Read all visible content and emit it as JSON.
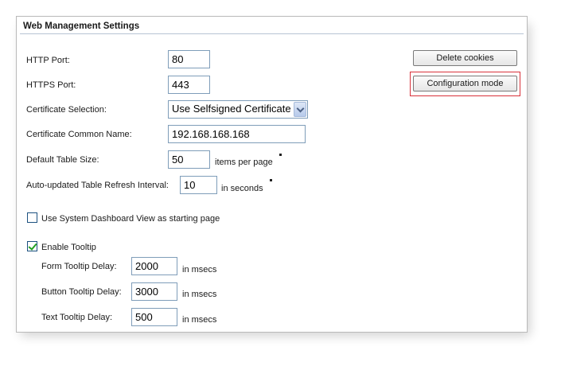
{
  "section": {
    "title": "Web Management Settings"
  },
  "fields": {
    "http_port": {
      "label": "HTTP Port:",
      "value": "80"
    },
    "https_port": {
      "label": "HTTPS Port:",
      "value": "443"
    },
    "cert_selection": {
      "label": "Certificate Selection:",
      "value": "Use Selfsigned Certificate"
    },
    "cert_common_name": {
      "label": "Certificate Common Name:",
      "value": "192.168.168.168"
    },
    "table_size": {
      "label": "Default Table Size:",
      "value": "50",
      "suffix": "items per page"
    },
    "refresh_interval": {
      "label": "Auto-updated Table Refresh Interval:",
      "value": "10",
      "suffix": "in seconds"
    }
  },
  "options": {
    "dashboard_start": {
      "label": "Use System Dashboard View as starting page",
      "checked": false
    },
    "enable_tooltip": {
      "label": "Enable Tooltip",
      "checked": true
    }
  },
  "tooltips": {
    "form": {
      "label": "Form Tooltip Delay:",
      "value": "2000",
      "suffix": "in msecs"
    },
    "button": {
      "label": "Button Tooltip Delay:",
      "value": "3000",
      "suffix": "in msecs"
    },
    "text": {
      "label": "Text Tooltip Delay:",
      "value": "500",
      "suffix": "in msecs"
    }
  },
  "buttons": {
    "delete_cookies": "Delete cookies",
    "configuration_mode": "Configuration mode"
  },
  "colors": {
    "highlight": "#d9313a",
    "input_border": "#7f9db9",
    "check": "#21a121"
  },
  "icons": {
    "select_arrow": "chevron-down-icon",
    "check": "checkmark-icon"
  }
}
